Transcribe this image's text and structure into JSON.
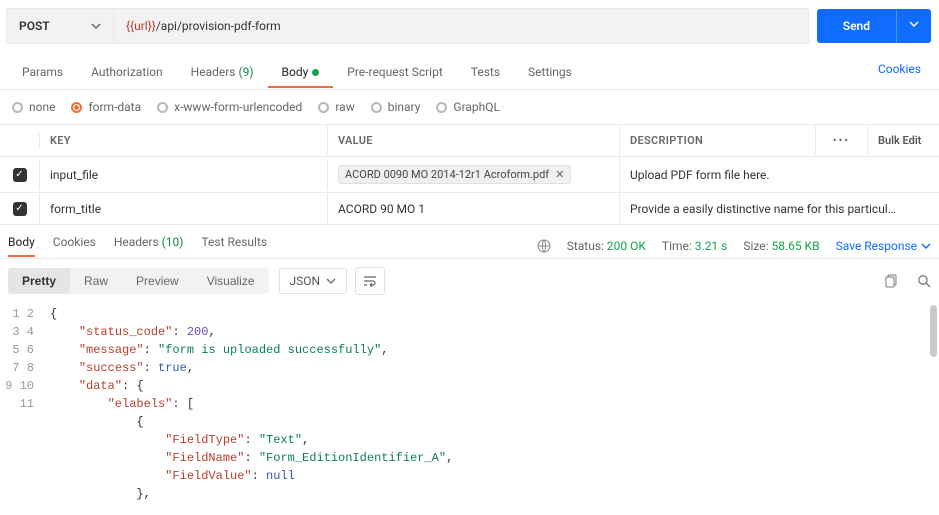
{
  "request": {
    "method": "POST",
    "url_prefix": "{{url}}",
    "url_path": "/api/provision-pdf-form",
    "send_label": "Send"
  },
  "tabs": {
    "params": "Params",
    "authorization": "Authorization",
    "headers": "Headers",
    "headers_count": "(9)",
    "body": "Body",
    "prerequest": "Pre-request Script",
    "tests": "Tests",
    "settings": "Settings",
    "cookies": "Cookies"
  },
  "bodytypes": {
    "none": "none",
    "formdata": "form-data",
    "xwww": "x-www-form-urlencoded",
    "raw": "raw",
    "binary": "binary",
    "graphql": "GraphQL"
  },
  "kv": {
    "headers": {
      "key": "KEY",
      "value": "VALUE",
      "desc": "DESCRIPTION",
      "bulk": "Bulk Edit"
    },
    "rows": [
      {
        "key": "input_file",
        "file": "ACORD 0090 MO 2014-12r1 Acroform.pdf",
        "desc": "Upload PDF form file here."
      },
      {
        "key": "form_title",
        "value": "ACORD 90 MO 1",
        "desc": "Provide a easily distinctive name for this particul…"
      }
    ]
  },
  "response": {
    "tabs": {
      "body": "Body",
      "cookies": "Cookies",
      "headers": "Headers",
      "headers_count": "(10)",
      "test": "Test Results"
    },
    "status_label": "Status:",
    "status_value": "200 OK",
    "time_label": "Time:",
    "time_value": "3.21 s",
    "size_label": "Size:",
    "size_value": "58.65 KB",
    "save": "Save Response",
    "views": {
      "pretty": "Pretty",
      "raw": "Raw",
      "preview": "Preview",
      "visualize": "Visualize"
    },
    "lang": "JSON"
  },
  "json_body": {
    "status_code": 200,
    "message": "form is uploaded successfully",
    "success": true,
    "fields": [
      {
        "FieldType": "Text",
        "FieldName": "Form_EditionIdentifier_A",
        "FieldValue": null
      }
    ]
  },
  "code_tokens": {
    "status_code": "\"status_code\"",
    "message": "\"message\"",
    "success": "\"success\"",
    "data": "\"data\"",
    "elabels": "\"elabels\"",
    "FieldType": "\"FieldType\"",
    "FieldName": "\"FieldName\"",
    "FieldValue": "\"FieldValue\"",
    "v200": "200",
    "vmsg": "\"form is uploaded successfully\"",
    "vtrue": "true",
    "vtext": "\"Text\"",
    "vfname": "\"Form_EditionIdentifier_A\"",
    "vnull": "null"
  }
}
